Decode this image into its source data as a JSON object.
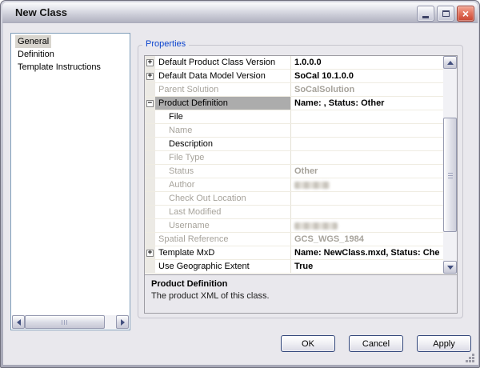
{
  "window": {
    "title": "New Class"
  },
  "icons": {
    "plus": "+",
    "minus": "−",
    "close": "×"
  },
  "nav_list": {
    "items": [
      {
        "label": "General",
        "selected": true
      },
      {
        "label": "Definition",
        "selected": false
      },
      {
        "label": "Template Instructions",
        "selected": false
      }
    ]
  },
  "properties_panel": {
    "group_label": "Properties",
    "grid": {
      "rows": [
        {
          "label": "Default Product Class Version",
          "expand": "plus",
          "value": "1.0.0.0"
        },
        {
          "label": "Default Data Model Version",
          "expand": "plus",
          "value": "SoCal 10.1.0.0"
        },
        {
          "label": "Parent Solution",
          "readonly": true,
          "value": "SoCalSolution",
          "value_gray": true
        },
        {
          "label": "Product Definition",
          "expand": "minus",
          "selected": true,
          "value": "Name: , Status: Other"
        },
        {
          "label": "File",
          "level": 1
        },
        {
          "label": "Name",
          "level": 1,
          "readonly": true
        },
        {
          "label": "Description",
          "level": 1
        },
        {
          "label": "File Type",
          "level": 1,
          "readonly": true
        },
        {
          "label": "Status",
          "level": 1,
          "readonly": true,
          "value": "Other",
          "value_gray": true
        },
        {
          "label": "Author",
          "level": 1,
          "readonly": true,
          "redacted": "w1"
        },
        {
          "label": "Check Out Location",
          "level": 1,
          "readonly": true
        },
        {
          "label": "Last Modified",
          "level": 1,
          "readonly": true
        },
        {
          "label": "Username",
          "level": 1,
          "readonly": true,
          "redacted": "w2"
        },
        {
          "label": "Spatial Reference",
          "readonly": true,
          "value": "GCS_WGS_1984",
          "value_gray": true
        },
        {
          "label": "Template MxD",
          "expand": "plus",
          "value": "Name: NewClass.mxd, Status: Che"
        },
        {
          "label": "Use Geographic Extent",
          "value": "True"
        }
      ]
    },
    "help": {
      "title": "Product Definition",
      "description": "The product XML of this class."
    }
  },
  "buttons": {
    "ok": "OK",
    "cancel": "Cancel",
    "apply": "Apply"
  },
  "colors": {
    "group_label_blue": "#0B44CE",
    "selected_row_bg": "#ACACAC",
    "disabled_text": "#A7A39B",
    "close_button_red": "#C94531",
    "listbox_border": "#7F9DB9",
    "client_bg": "#E9E8ED"
  }
}
